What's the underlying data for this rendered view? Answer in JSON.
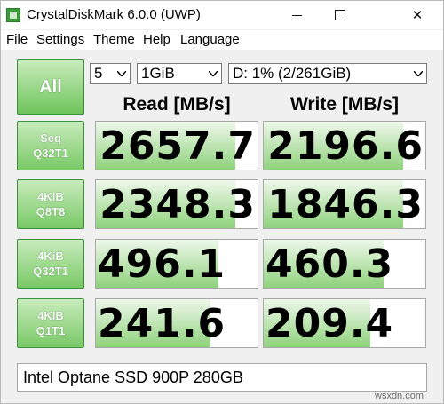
{
  "window": {
    "title": "CrystalDiskMark 6.0.0 (UWP)",
    "controls": {
      "minimize": "",
      "maximize": "",
      "close": "✕"
    }
  },
  "menu": [
    {
      "label": "File"
    },
    {
      "label": "Settings"
    },
    {
      "label": "Theme"
    },
    {
      "label": "Help"
    },
    {
      "label": "Language"
    }
  ],
  "toolbar": {
    "all_label": "All",
    "count_value": "5",
    "size_value": "1GiB",
    "drive_value": "D: 1% (2/261GiB)"
  },
  "columns": {
    "read": "Read [MB/s]",
    "write": "Write [MB/s]"
  },
  "tests": [
    {
      "line1": "Seq",
      "line2": "Q32T1",
      "read": "2657.7",
      "write": "2196.6",
      "read_fill": 0.86,
      "write_fill": 0.86
    },
    {
      "line1": "4KiB",
      "line2": "Q8T8",
      "read": "2348.3",
      "write": "1846.3",
      "read_fill": 0.86,
      "write_fill": 0.86
    },
    {
      "line1": "4KiB",
      "line2": "Q32T1",
      "read": "496.1",
      "write": "460.3",
      "read_fill": 0.76,
      "write_fill": 0.74
    },
    {
      "line1": "4KiB",
      "line2": "Q1T1",
      "read": "241.6",
      "write": "209.4",
      "read_fill": 0.71,
      "write_fill": 0.66
    }
  ],
  "comment": "Intel Optane SSD 900P 280GB",
  "watermark": "wsxdn.com",
  "colors": {
    "accent_green": "#6ec45a",
    "border_green": "#3c8f3c"
  }
}
